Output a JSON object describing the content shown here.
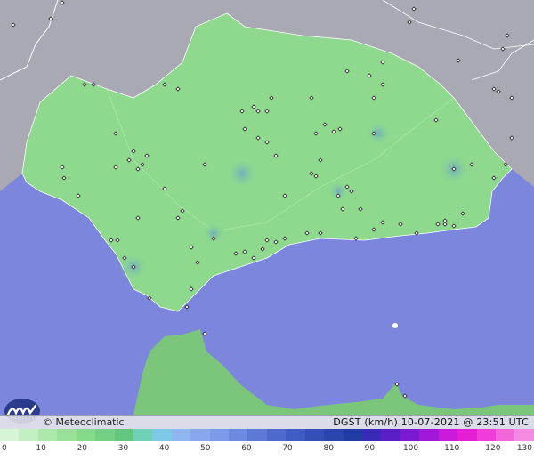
{
  "credit": "© Meteoclimatic",
  "info": "DGST (km/h)  10-07-2021 @ 23:51 UTC",
  "logo_icon": "meteoclimatic-logo-icon",
  "legend": {
    "ticks": [
      "0",
      "10",
      "20",
      "30",
      "40",
      "50",
      "60",
      "70",
      "80",
      "90",
      "100",
      "110",
      "120",
      "130"
    ],
    "colors": [
      "#d6f5d6",
      "#c2efc2",
      "#ace8ac",
      "#98e198",
      "#84db8a",
      "#74d184",
      "#62c77c",
      "#70d0b8",
      "#7ec8e8",
      "#8fb6f0",
      "#8aa6ef",
      "#7e98ea",
      "#6f88e0",
      "#5d78d6",
      "#4d69cc",
      "#3f5cc2",
      "#3450b8",
      "#2a46ae",
      "#213ca4",
      "#3a2ab8",
      "#5a1fc4",
      "#7b1ad0",
      "#a018d8",
      "#c81ad8",
      "#e41ed2",
      "#f03cd8",
      "#f266dc",
      "#f48ae2"
    ]
  },
  "colors": {
    "sea": "#7b86dc",
    "land_region": "#8ed98e",
    "land_neighbor": "#a9a9b3",
    "africa": "#7cc67c"
  },
  "stations_icon": "station-marker-icon"
}
